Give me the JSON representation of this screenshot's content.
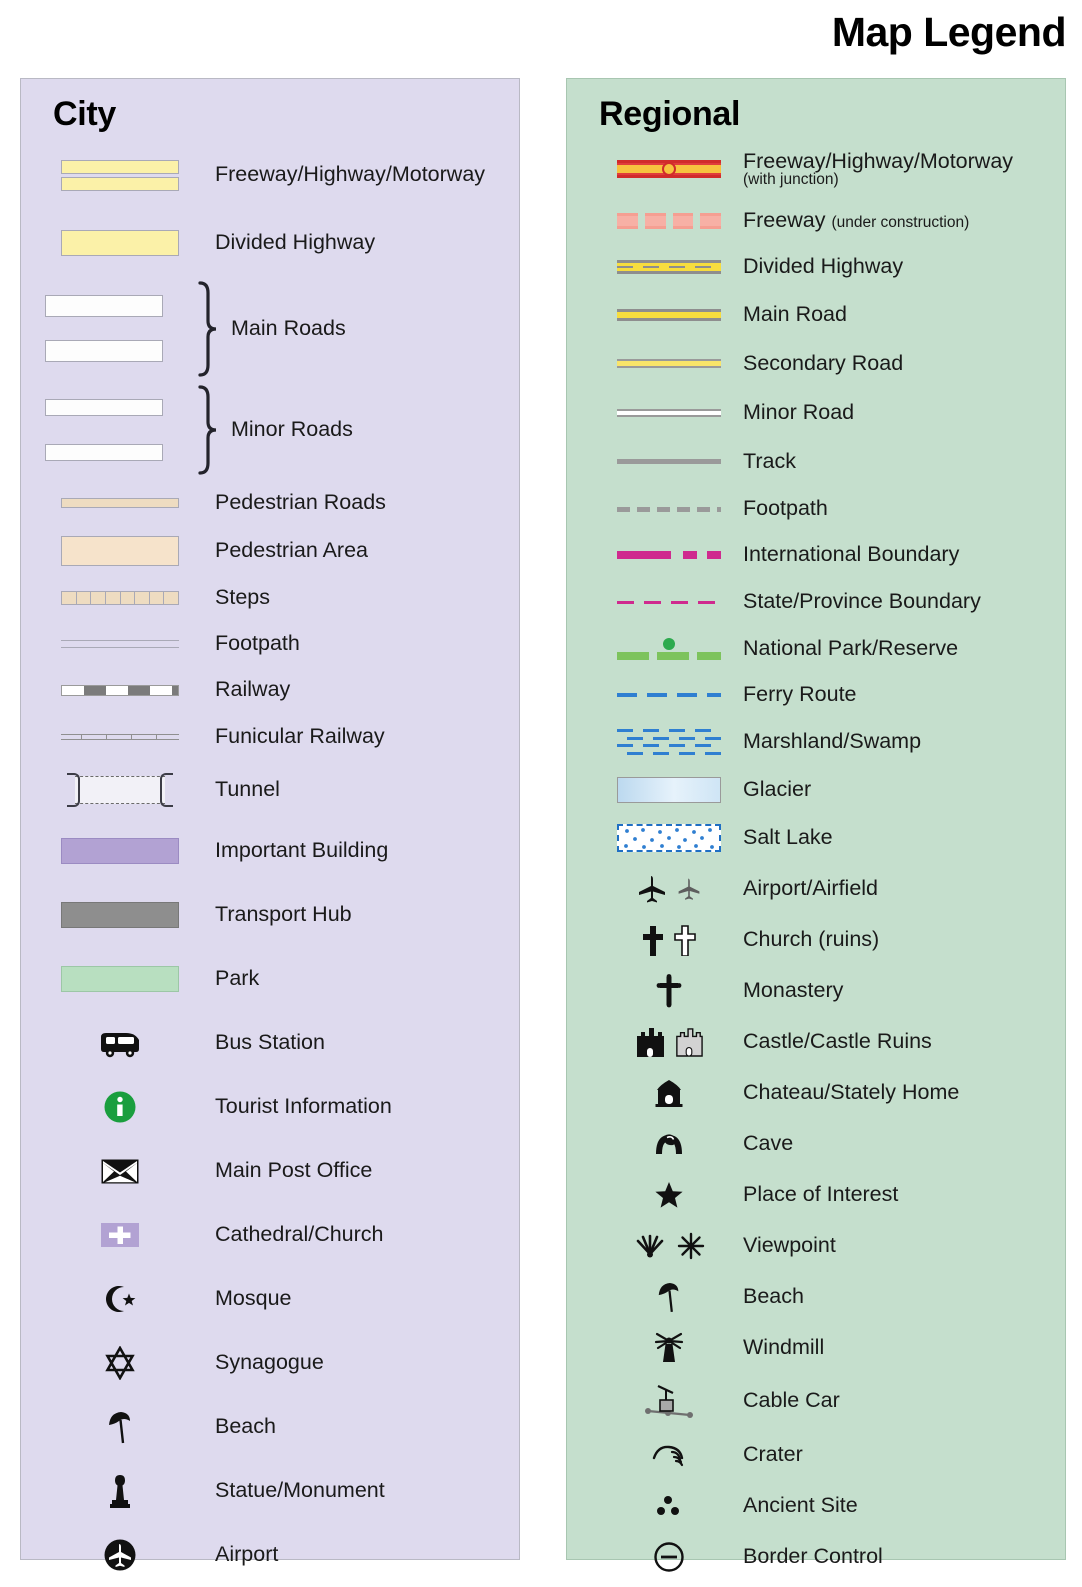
{
  "title": "Map Legend",
  "panels": {
    "city": {
      "heading": "City",
      "background_color": "#dedaee",
      "items": [
        {
          "label": "Freeway/Highway/Motorway",
          "symbol": "double-yellow-bar-swatch"
        },
        {
          "label": "Divided Highway",
          "symbol": "yellow-bar-swatch"
        },
        {
          "label": "Main Roads",
          "symbol": "white-bar-pair-brace-swatch"
        },
        {
          "label": "Minor Roads",
          "symbol": "white-thin-bar-pair-brace-swatch"
        },
        {
          "label": "Pedestrian Roads",
          "symbol": "tan-thin-bar-swatch"
        },
        {
          "label": "Pedestrian Area",
          "symbol": "tan-area-swatch"
        },
        {
          "label": "Steps",
          "symbol": "stepped-blocks-swatch"
        },
        {
          "label": "Footpath",
          "symbol": "thin-double-line-swatch"
        },
        {
          "label": "Railway",
          "symbol": "dashed-railway-swatch"
        },
        {
          "label": "Funicular Railway",
          "symbol": "ticked-railway-swatch"
        },
        {
          "label": "Tunnel",
          "symbol": "tunnel-bracket-swatch"
        },
        {
          "label": "Important Building",
          "symbol": "purple-area-swatch"
        },
        {
          "label": "Transport Hub",
          "symbol": "grey-area-swatch"
        },
        {
          "label": "Park",
          "symbol": "green-area-swatch"
        },
        {
          "label": "Bus Station",
          "symbol": "bus-icon"
        },
        {
          "label": "Tourist Information",
          "symbol": "information-circle-icon"
        },
        {
          "label": "Main Post Office",
          "symbol": "envelope-icon"
        },
        {
          "label": "Cathedral/Church",
          "symbol": "church-cross-badge-icon"
        },
        {
          "label": "Mosque",
          "symbol": "crescent-star-icon"
        },
        {
          "label": "Synagogue",
          "symbol": "star-of-david-icon"
        },
        {
          "label": "Beach",
          "symbol": "beach-parasol-icon"
        },
        {
          "label": "Statue/Monument",
          "symbol": "statue-icon"
        },
        {
          "label": "Airport",
          "symbol": "airport-circle-icon"
        }
      ]
    },
    "regional": {
      "heading": "Regional",
      "background_color": "#c5dfcd",
      "items": [
        {
          "label": "Freeway/Highway/Motorway",
          "sublabel": "(with junction)",
          "sub_style": "block",
          "symbol": "red-yellow-freeway-junction-line"
        },
        {
          "label": "Freeway",
          "sublabel": "(under construction)",
          "sub_style": "inline",
          "symbol": "pink-dashed-freeway-line"
        },
        {
          "label": "Divided Highway",
          "symbol": "yellow-divided-line"
        },
        {
          "label": "Main Road",
          "symbol": "yellow-main-road-line"
        },
        {
          "label": "Secondary Road",
          "symbol": "yellow-secondary-road-line"
        },
        {
          "label": "Minor Road",
          "symbol": "white-minor-road-line"
        },
        {
          "label": "Track",
          "symbol": "grey-track-line"
        },
        {
          "label": "Footpath",
          "symbol": "grey-dashed-footpath-line"
        },
        {
          "label": "International Boundary",
          "symbol": "magenta-dash-dot-line"
        },
        {
          "label": "State/Province Boundary",
          "symbol": "magenta-dashed-line"
        },
        {
          "label": "National Park/Reserve",
          "symbol": "green-band-dot-line"
        },
        {
          "label": "Ferry Route",
          "symbol": "blue-dashed-ferry-line"
        },
        {
          "label": "Marshland/Swamp",
          "symbol": "blue-marsh-dashes-swatch"
        },
        {
          "label": "Glacier",
          "symbol": "glacier-gradient-swatch"
        },
        {
          "label": "Salt Lake",
          "symbol": "salt-lake-dotted-swatch"
        },
        {
          "label": "Airport/Airfield",
          "symbol": "airplane-pair-icon"
        },
        {
          "label": "Church (ruins)",
          "symbol": "cross-pair-icon"
        },
        {
          "label": "Monastery",
          "symbol": "monastery-cross-icon"
        },
        {
          "label": "Castle/Castle Ruins",
          "symbol": "castle-pair-icon"
        },
        {
          "label": "Chateau/Stately Home",
          "symbol": "chateau-icon"
        },
        {
          "label": "Cave",
          "symbol": "cave-icon"
        },
        {
          "label": "Place of Interest",
          "symbol": "star-icon"
        },
        {
          "label": "Viewpoint",
          "symbol": "viewpoint-pair-icon"
        },
        {
          "label": "Beach",
          "symbol": "beach-parasol-icon"
        },
        {
          "label": "Windmill",
          "symbol": "windmill-icon"
        },
        {
          "label": "Cable Car",
          "symbol": "cable-car-icon"
        },
        {
          "label": "Crater",
          "symbol": "crater-icon"
        },
        {
          "label": "Ancient Site",
          "symbol": "ancient-site-dots-icon"
        },
        {
          "label": "Border Control",
          "symbol": "border-control-icon"
        }
      ]
    }
  },
  "colors": {
    "city_panel": "#dedaee",
    "regional_panel": "#c5dfcd",
    "highway_yellow": "#fbf1a8",
    "freeway_red": "#e03c3c",
    "freeway_yellow": "#f7c23f",
    "boundary_magenta": "#cf2a8e",
    "park_green": "#7dc35c",
    "ferry_blue": "#2f7fd1",
    "important_building_purple": "#b2a2d3",
    "transport_hub_grey": "#8e8e8e",
    "park_area_green": "#b8dfc0",
    "pedestrian_tan": "#eedcc1",
    "tourist_info_green": "#1a9e3e"
  }
}
